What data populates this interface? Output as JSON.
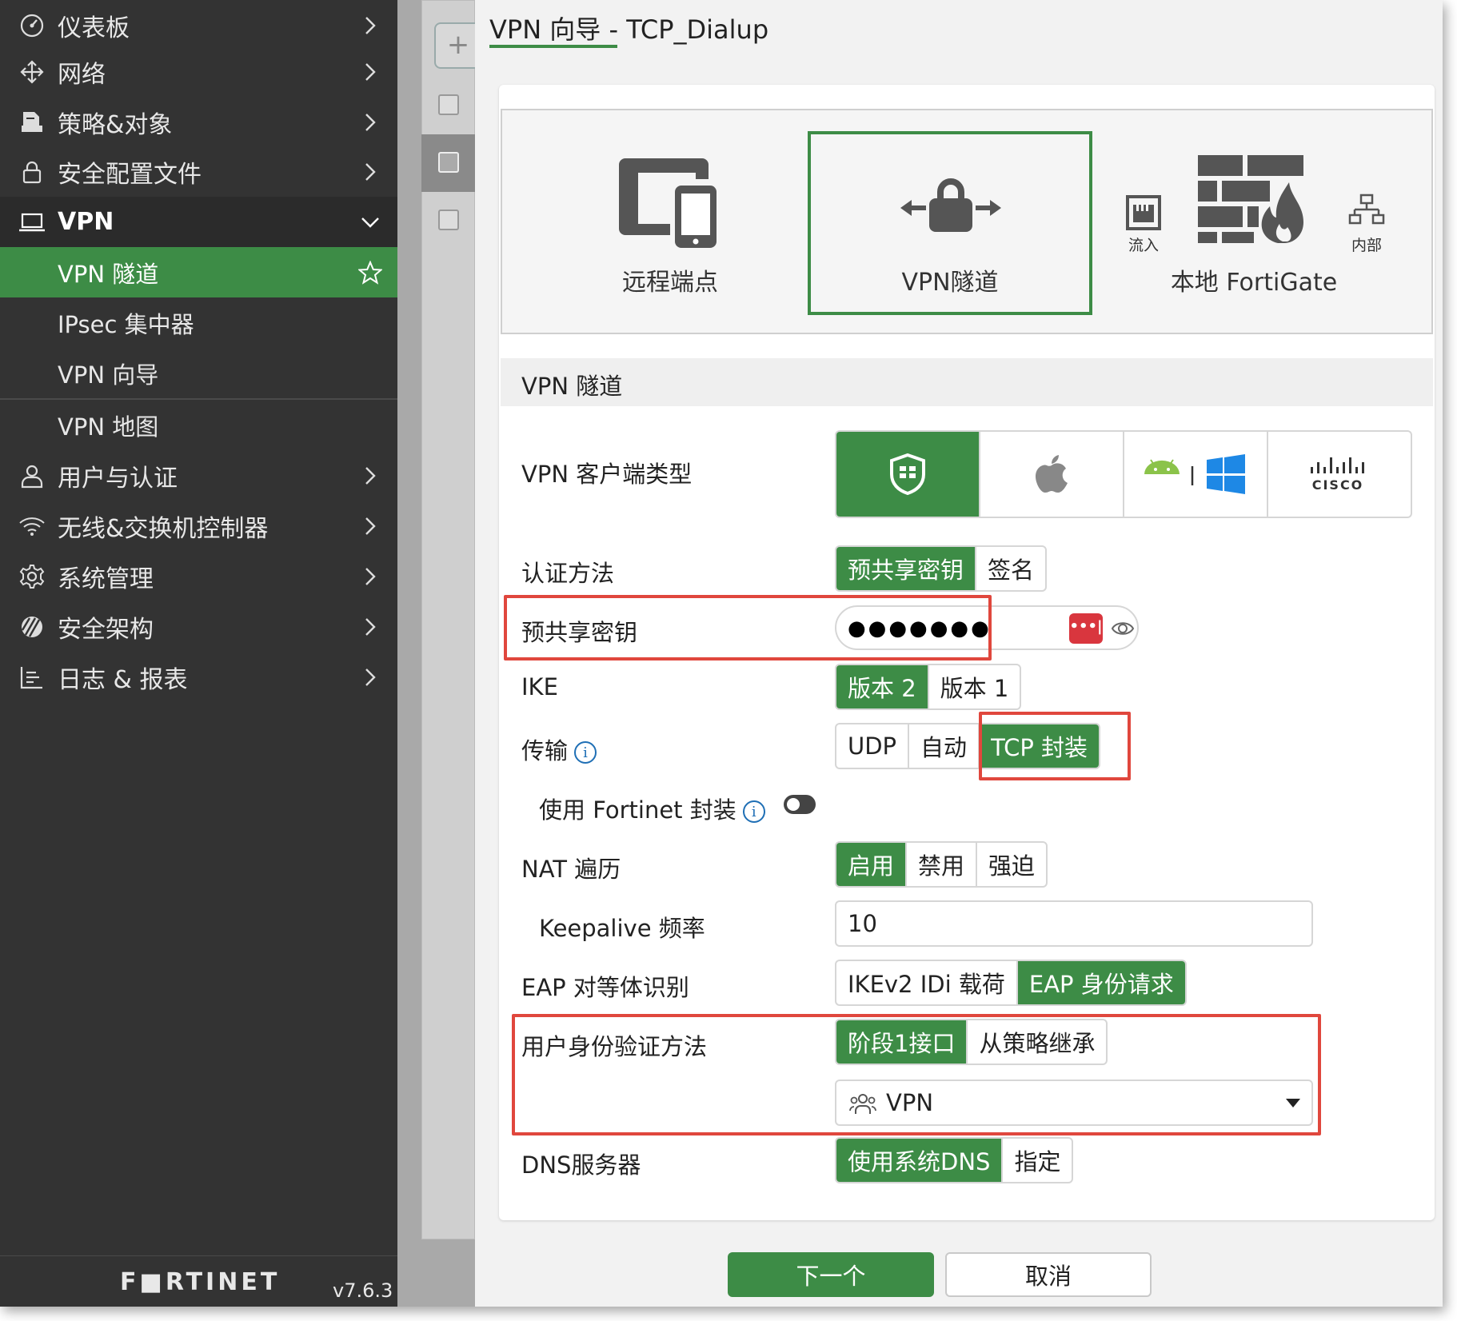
{
  "sidebar": {
    "items": [
      {
        "label": "仪表板",
        "icon": "dashboard-icon"
      },
      {
        "label": "网络",
        "icon": "network-icon"
      },
      {
        "label": "策略&对象",
        "icon": "policy-icon"
      },
      {
        "label": "安全配置文件",
        "icon": "lock-icon"
      },
      {
        "label": "VPN",
        "icon": "laptop-icon"
      },
      {
        "label": "VPN 隧道"
      },
      {
        "label": "IPsec 集中器"
      },
      {
        "label": "VPN 向导"
      },
      {
        "label": "VPN 地图"
      },
      {
        "label": "用户与认证",
        "icon": "user-icon"
      },
      {
        "label": "无线&交换机控制器",
        "icon": "wifi-icon"
      },
      {
        "label": "系统管理",
        "icon": "gear-icon"
      },
      {
        "label": "安全架构",
        "icon": "security-fabric-icon"
      },
      {
        "label": "日志 & 报表",
        "icon": "report-icon"
      }
    ],
    "logo": "F■RTINET",
    "version": "v7.6.3"
  },
  "background": {
    "add_button": "+"
  },
  "dialog": {
    "title": "VPN 向导 - TCP_Dialup",
    "topology": {
      "remote_label": "远程端点",
      "tunnel_label": "VPN隧道",
      "incoming_label": "流入",
      "internal_label": "内部",
      "local_label": "本地 FortiGate"
    },
    "section_title": "VPN 隧道",
    "client_type": {
      "label": "VPN 客户端类型",
      "options": [
        "forticlient-icon",
        "apple-icon",
        "android-windows-icon",
        "cisco-icon"
      ],
      "selected": 0,
      "cisco_text": "CISCO"
    },
    "auth_method": {
      "label": "认证方法",
      "options": [
        "预共享密钥",
        "签名"
      ],
      "selected": 0
    },
    "psk": {
      "label": "预共享密钥",
      "value": "●●●●●●●●●",
      "manager_text": "•••|"
    },
    "ike": {
      "label": "IKE",
      "options": [
        "版本 2",
        "版本 1"
      ],
      "selected": 0
    },
    "transport": {
      "label": "传输",
      "options": [
        "UDP",
        "自动",
        "TCP 封装"
      ],
      "selected": 2
    },
    "fortinet_encap": {
      "label": "使用 Fortinet 封装",
      "enabled": false
    },
    "nat_traversal": {
      "label": "NAT 遍历",
      "options": [
        "启用",
        "禁用",
        "强迫"
      ],
      "selected": 0
    },
    "keepalive": {
      "label": "Keepalive 频率",
      "value": "10"
    },
    "eap_peer": {
      "label": "EAP 对等体识别",
      "options": [
        "IKEv2 IDi 载荷",
        "EAP 身份请求"
      ],
      "selected": 1
    },
    "user_auth": {
      "label": "用户身份验证方法",
      "options": [
        "阶段1接口",
        "从策略继承"
      ],
      "selected": 0,
      "group_value": "VPN"
    },
    "dns": {
      "label": "DNS服务器",
      "options": [
        "使用系统DNS",
        "指定"
      ],
      "selected": 0
    },
    "next_button": "下一个",
    "cancel_button": "取消"
  },
  "colors": {
    "accent": "#3d8c46",
    "sidebar_bg": "#333333",
    "highlight": "#e0473d",
    "info": "#1f6fb5"
  }
}
